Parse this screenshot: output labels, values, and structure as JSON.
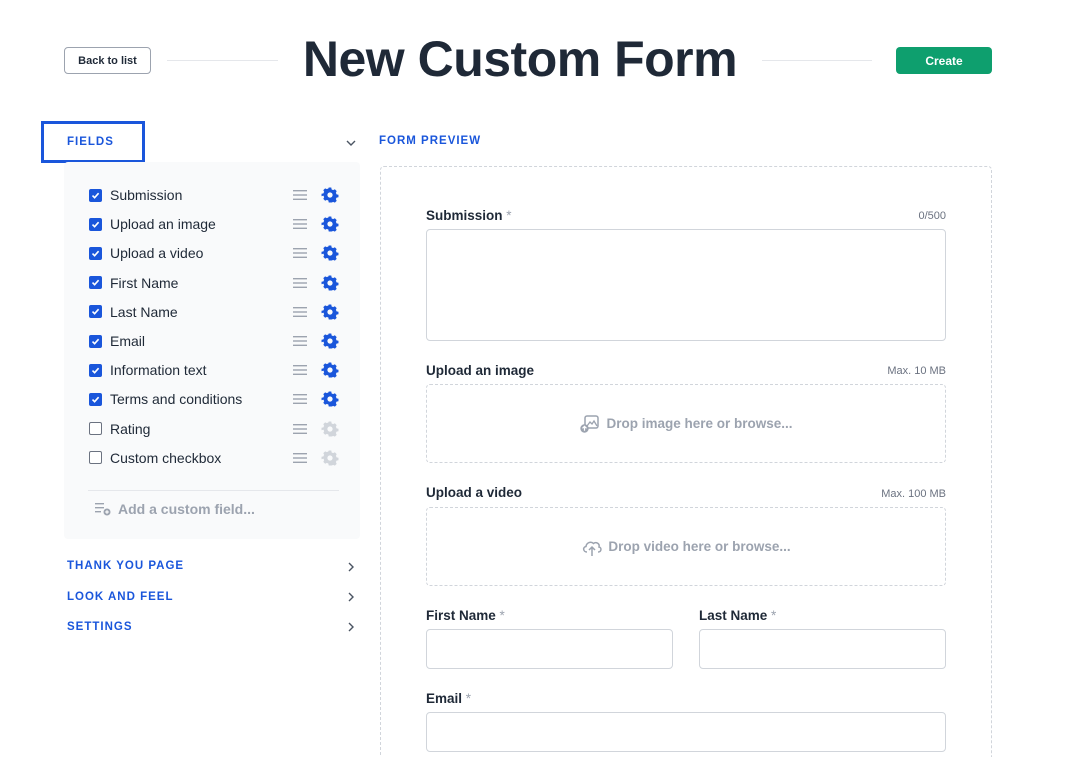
{
  "header": {
    "back_label": "Back to list",
    "title": "New Custom Form",
    "create_label": "Create"
  },
  "sidebar": {
    "fields_heading": "FIELDS",
    "fields": [
      {
        "label": "Submission",
        "checked": true
      },
      {
        "label": "Upload an image",
        "checked": true
      },
      {
        "label": "Upload a video",
        "checked": true
      },
      {
        "label": "First Name",
        "checked": true
      },
      {
        "label": "Last Name",
        "checked": true
      },
      {
        "label": "Email",
        "checked": true
      },
      {
        "label": "Information text",
        "checked": true
      },
      {
        "label": "Terms and conditions",
        "checked": true
      },
      {
        "label": "Rating",
        "checked": false
      },
      {
        "label": "Custom checkbox",
        "checked": false
      }
    ],
    "add_field_label": "Add a custom field...",
    "sections": {
      "thank_you": "THANK YOU PAGE",
      "look_and_feel": "LOOK AND FEEL",
      "settings": "SETTINGS"
    }
  },
  "preview": {
    "heading": "FORM PREVIEW",
    "submission": {
      "label": "Submission",
      "required_mark": "*",
      "counter": "0/500"
    },
    "image": {
      "label": "Upload an image",
      "max": "Max. 10 MB",
      "drop_text": "Drop image here or browse..."
    },
    "video": {
      "label": "Upload a video",
      "max": "Max. 100 MB",
      "drop_text": "Drop video here or browse..."
    },
    "first_name": {
      "label": "First Name",
      "required_mark": "*"
    },
    "last_name": {
      "label": "Last Name",
      "required_mark": "*"
    },
    "email": {
      "label": "Email",
      "required_mark": "*"
    }
  },
  "colors": {
    "accent": "#1a56db",
    "create": "#0e9f6e",
    "checkbox_on": "#1a56db",
    "gear_off": "#d1d5db"
  }
}
